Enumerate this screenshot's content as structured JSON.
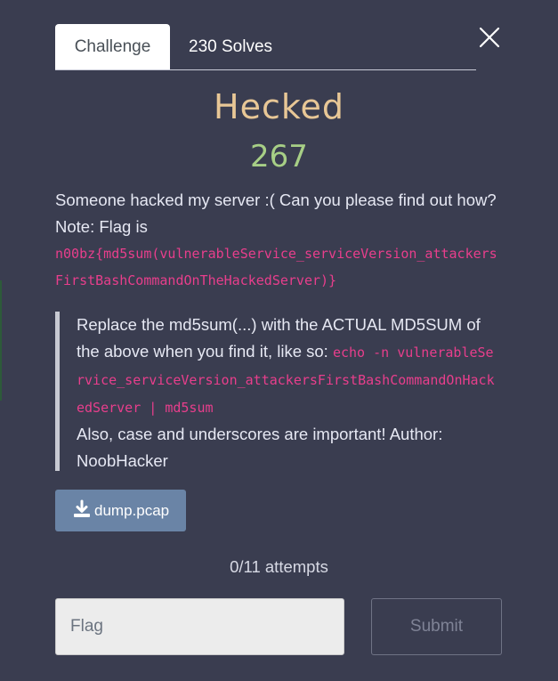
{
  "tabs": {
    "challenge_label": "Challenge",
    "solves_label": "230 Solves"
  },
  "challenge": {
    "name": "Hecked",
    "value": "267",
    "description_text": "Someone hacked my server :( Can you please find out how? Note: Flag is",
    "flag_format": "n00bz{md5sum(vulnerableService_serviceVersion_attackersFirstBashCommandOnTheHackedServer)}",
    "note_text": "Replace the md5sum(...) with the ACTUAL MD5SUM of the above when you find it, like so:",
    "note_code": "echo -n vulnerableService_serviceVersion_attackersFirstBashCommandOnHackedServer | md5sum",
    "note_tail": "Also, case and underscores are important! Author: NoobHacker"
  },
  "files": {
    "download_label": "dump.pcap"
  },
  "attempts": "0/11 attempts",
  "form": {
    "flag_placeholder": "Flag",
    "submit_label": "Submit"
  },
  "icons": {
    "close": "close-icon",
    "download": "download-icon"
  },
  "colors": {
    "background": "#3a3d50",
    "title": "#e8c796",
    "value": "#a7cf86",
    "code": "#e83e8c",
    "download_button": "#6a84a6"
  }
}
